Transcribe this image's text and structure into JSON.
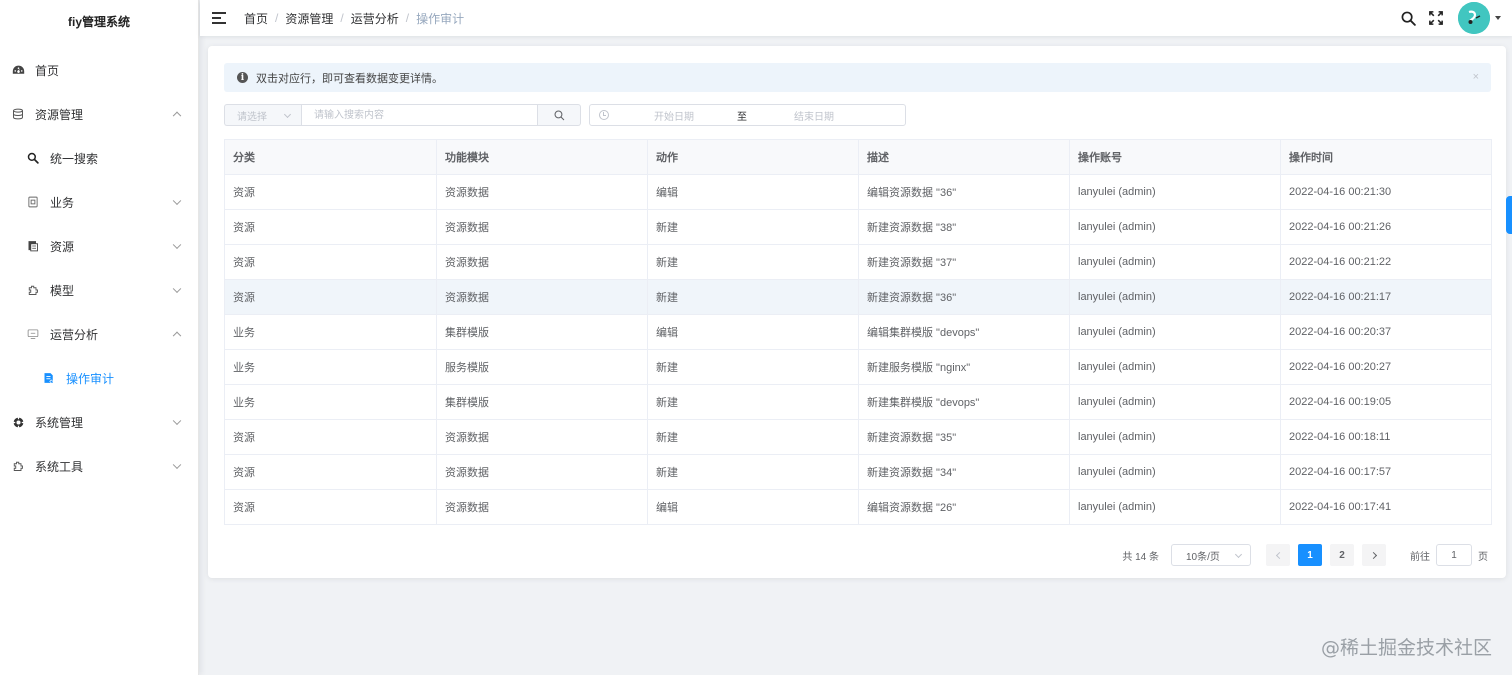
{
  "app": {
    "title": "fiy管理系统"
  },
  "sidebar": {
    "items": [
      {
        "label": "首页",
        "icon": "dashboard-icon"
      },
      {
        "label": "资源管理",
        "icon": "database-icon"
      },
      {
        "label": "统一搜索",
        "icon": "search-icon"
      },
      {
        "label": "业务",
        "icon": "business-icon"
      },
      {
        "label": "资源",
        "icon": "resource-icon"
      },
      {
        "label": "模型",
        "icon": "model-icon"
      },
      {
        "label": "运营分析",
        "icon": "monitor-icon"
      },
      {
        "label": "操作审计",
        "icon": "audit-doc-icon",
        "active": true
      },
      {
        "label": "系统管理",
        "icon": "system-gear-icon"
      },
      {
        "label": "系统工具",
        "icon": "tool-icon"
      }
    ]
  },
  "header": {
    "breadcrumb": [
      "首页",
      "资源管理",
      "运营分析",
      "操作审计"
    ],
    "separator": "/"
  },
  "alert": {
    "text": "双击对应行，即可查看数据变更详情。",
    "close": "×"
  },
  "filters": {
    "select_placeholder": "请选择",
    "search_placeholder": "请输入搜索内容",
    "date_start_placeholder": "开始日期",
    "date_separator": "至",
    "date_end_placeholder": "结束日期"
  },
  "table": {
    "columns": [
      "分类",
      "功能模块",
      "动作",
      "描述",
      "操作账号",
      "操作时间"
    ],
    "rows": [
      [
        "资源",
        "资源数据",
        "编辑",
        "编辑资源数据 \"36\"",
        "lanyulei (admin)",
        "2022-04-16 00:21:30"
      ],
      [
        "资源",
        "资源数据",
        "新建",
        "新建资源数据 \"38\"",
        "lanyulei (admin)",
        "2022-04-16 00:21:26"
      ],
      [
        "资源",
        "资源数据",
        "新建",
        "新建资源数据 \"37\"",
        "lanyulei (admin)",
        "2022-04-16 00:21:22"
      ],
      [
        "资源",
        "资源数据",
        "新建",
        "新建资源数据 \"36\"",
        "lanyulei (admin)",
        "2022-04-16 00:21:17"
      ],
      [
        "业务",
        "集群模版",
        "编辑",
        "编辑集群模版 \"devops\"",
        "lanyulei (admin)",
        "2022-04-16 00:20:37"
      ],
      [
        "业务",
        "服务模版",
        "新建",
        "新建服务模版 \"nginx\"",
        "lanyulei (admin)",
        "2022-04-16 00:20:27"
      ],
      [
        "业务",
        "集群模版",
        "新建",
        "新建集群模版 \"devops\"",
        "lanyulei (admin)",
        "2022-04-16 00:19:05"
      ],
      [
        "资源",
        "资源数据",
        "新建",
        "新建资源数据 \"35\"",
        "lanyulei (admin)",
        "2022-04-16 00:18:11"
      ],
      [
        "资源",
        "资源数据",
        "新建",
        "新建资源数据 \"34\"",
        "lanyulei (admin)",
        "2022-04-16 00:17:57"
      ],
      [
        "资源",
        "资源数据",
        "编辑",
        "编辑资源数据 \"26\"",
        "lanyulei (admin)",
        "2022-04-16 00:17:41"
      ]
    ]
  },
  "pagination": {
    "total": "共 14 条",
    "page_size": "10条/页",
    "pages": [
      "1",
      "2"
    ],
    "current": "1",
    "jump_label": "前往",
    "jump_value": "1",
    "jump_suffix": "页"
  },
  "watermark": "@稀土掘金技术社区",
  "colors": {
    "accent": "#1890ff",
    "avatar_bg": "#41c6c0",
    "alert_bg": "#edf4fb"
  }
}
